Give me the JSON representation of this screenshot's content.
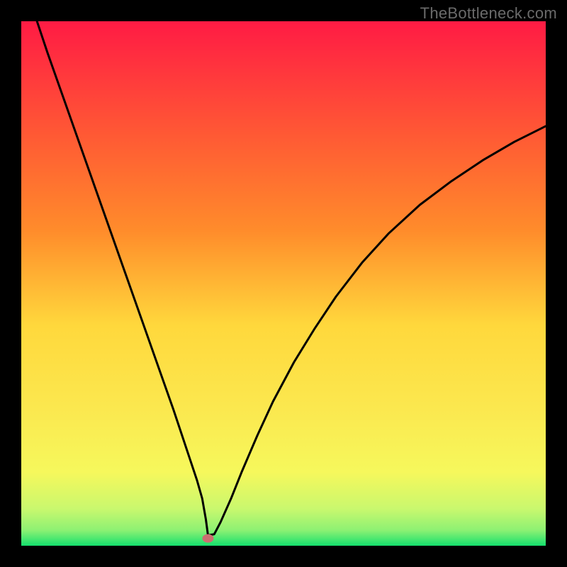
{
  "watermark": "TheBottleneck.com",
  "chart_data": {
    "type": "line",
    "title": "",
    "xlabel": "",
    "ylabel": "",
    "xlim": [
      0,
      100
    ],
    "ylim": [
      0,
      100
    ],
    "background_gradient": {
      "top": "#FF1B44",
      "upper_mid": "#FF8C2B",
      "mid": "#FFD83C",
      "lower_mid": "#F6F85C",
      "near_bottom": "#C9F86E",
      "bottom": "#15E06E"
    },
    "series": [
      {
        "name": "curve",
        "stroke": "#000000",
        "x": [
          3,
          5,
          8,
          11,
          14,
          17,
          20,
          23,
          26,
          29,
          32,
          33.5,
          34.5,
          35.2,
          35.6,
          36.8,
          38,
          40,
          42,
          45,
          48,
          52,
          56,
          60,
          65,
          70,
          76,
          82,
          88,
          94,
          100
        ],
        "y": [
          100,
          94,
          85.5,
          77,
          68.5,
          60,
          51.5,
          43,
          34.5,
          26,
          17,
          12.5,
          9,
          5,
          2,
          2.2,
          4.5,
          9,
          14,
          21,
          27.5,
          35,
          41.5,
          47.5,
          54,
          59.5,
          65,
          69.5,
          73.5,
          77,
          80
        ]
      }
    ],
    "min_marker": {
      "x": 35.6,
      "y": 1.4,
      "color": "#CC6F70"
    }
  }
}
